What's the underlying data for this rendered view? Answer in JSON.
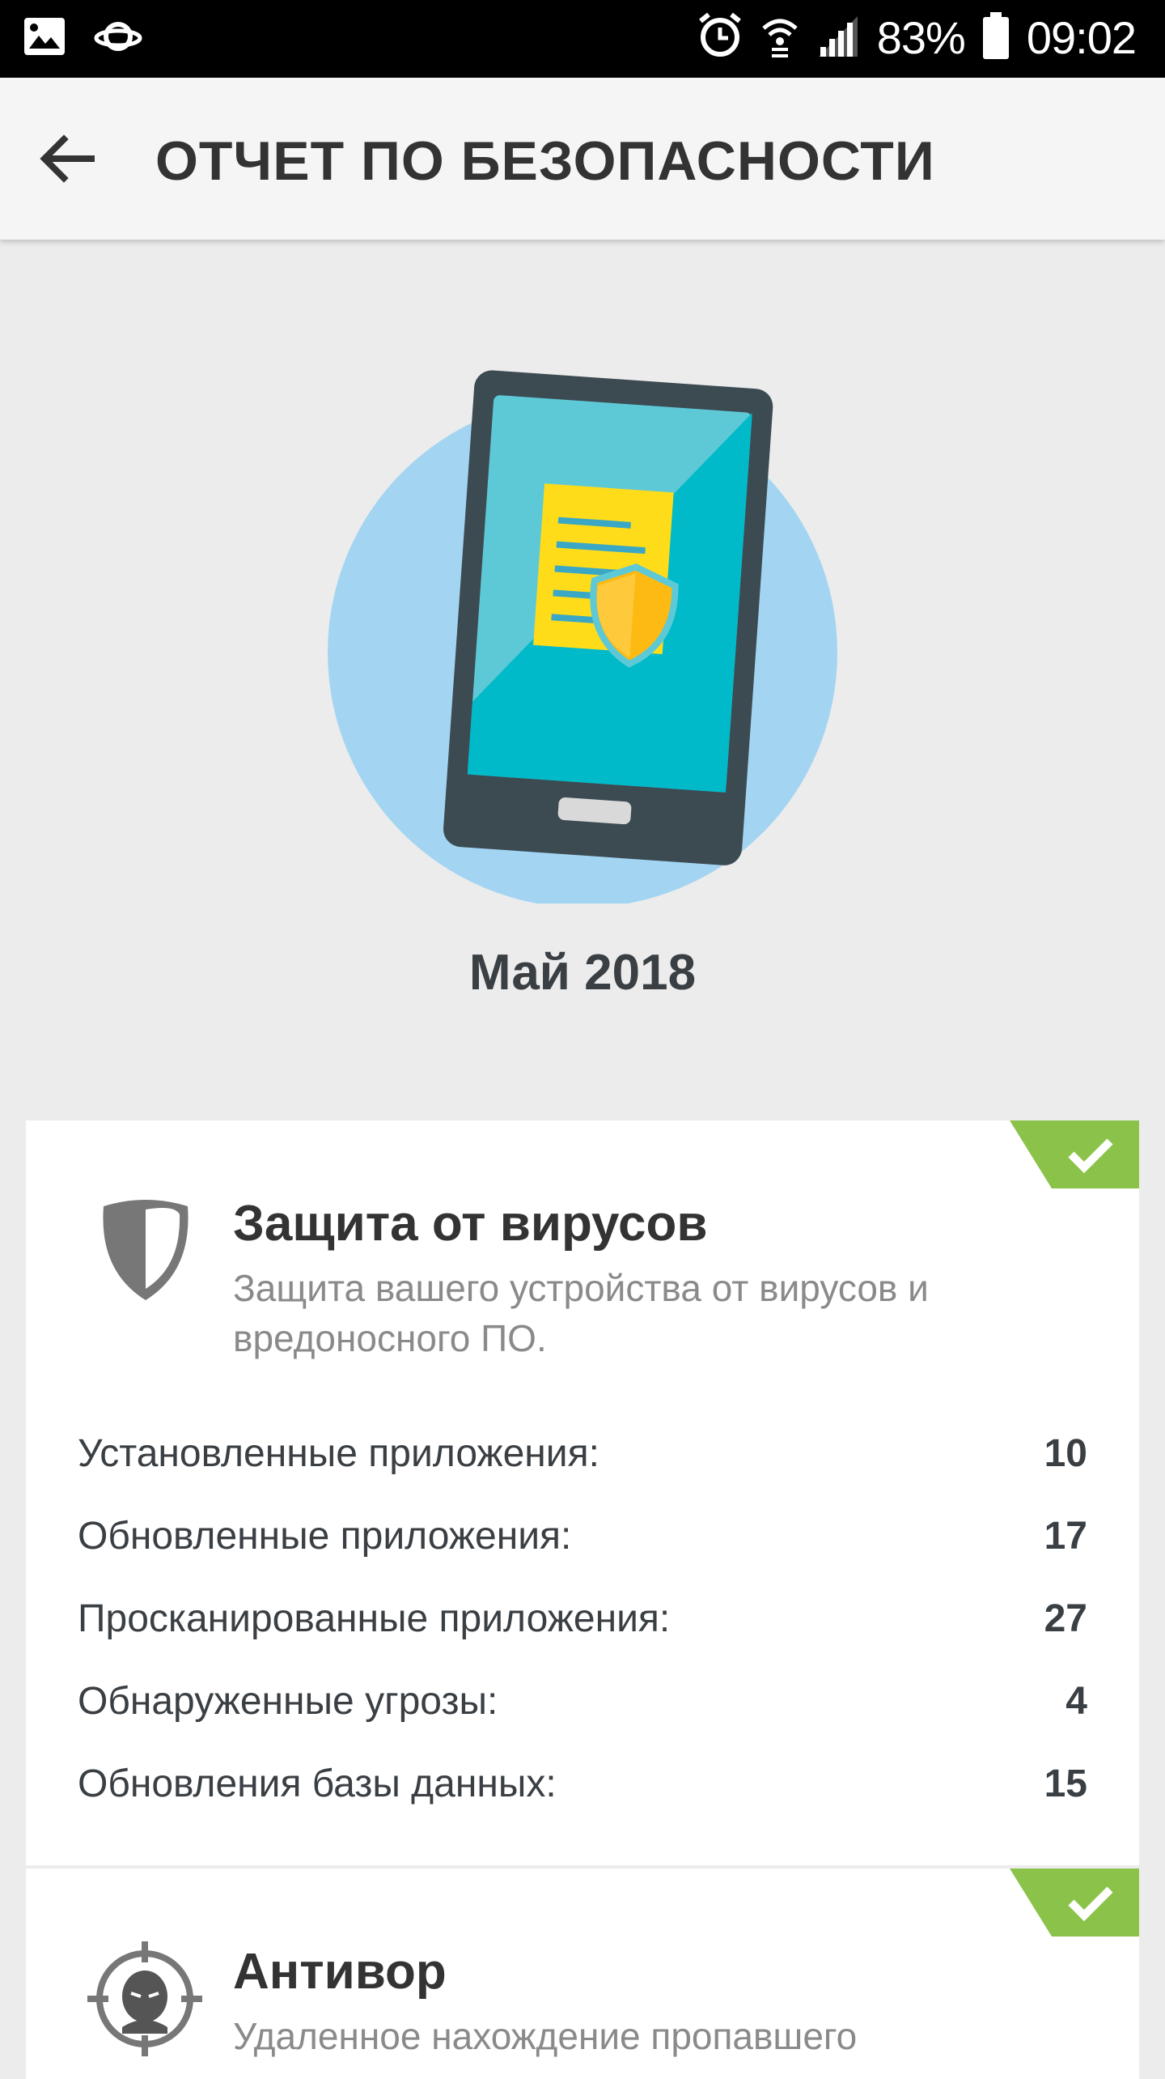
{
  "status_bar": {
    "battery": "83%",
    "time": "09:02",
    "icons": [
      "image-icon",
      "saturn-icon",
      "alarm-icon",
      "wifi-icon",
      "signal-icon",
      "battery-icon"
    ]
  },
  "app_bar": {
    "title": "ОТЧЕТ ПО БЕЗОПАСНОСТИ",
    "back_icon": "arrow-left-icon"
  },
  "hero": {
    "month": "Май 2018",
    "illustration": "phone-document-shield"
  },
  "cards": [
    {
      "title": "Защита от вирусов",
      "description": "Защита вашего устройства от вирусов и вредоносного ПО.",
      "icon": "shield-icon",
      "status": "check",
      "stats": [
        {
          "label": "Установленные приложения:",
          "value": "10"
        },
        {
          "label": "Обновленные приложения:",
          "value": "17"
        },
        {
          "label": "Просканированные приложения:",
          "value": "27"
        },
        {
          "label": "Обнаруженные угрозы:",
          "value": "4"
        },
        {
          "label": "Обновления базы данных:",
          "value": "15"
        }
      ]
    },
    {
      "title": "Антивор",
      "description": "Удаленное нахождение пропавшего",
      "icon": "thief-target-icon",
      "status": "check"
    }
  ],
  "colors": {
    "accent_green": "#8bc34a",
    "circle_blue": "#a3d5f2",
    "screen_teal": "#00bac9",
    "doc_yellow": "#ffdc1a",
    "shield_orange": "#fdba12"
  }
}
